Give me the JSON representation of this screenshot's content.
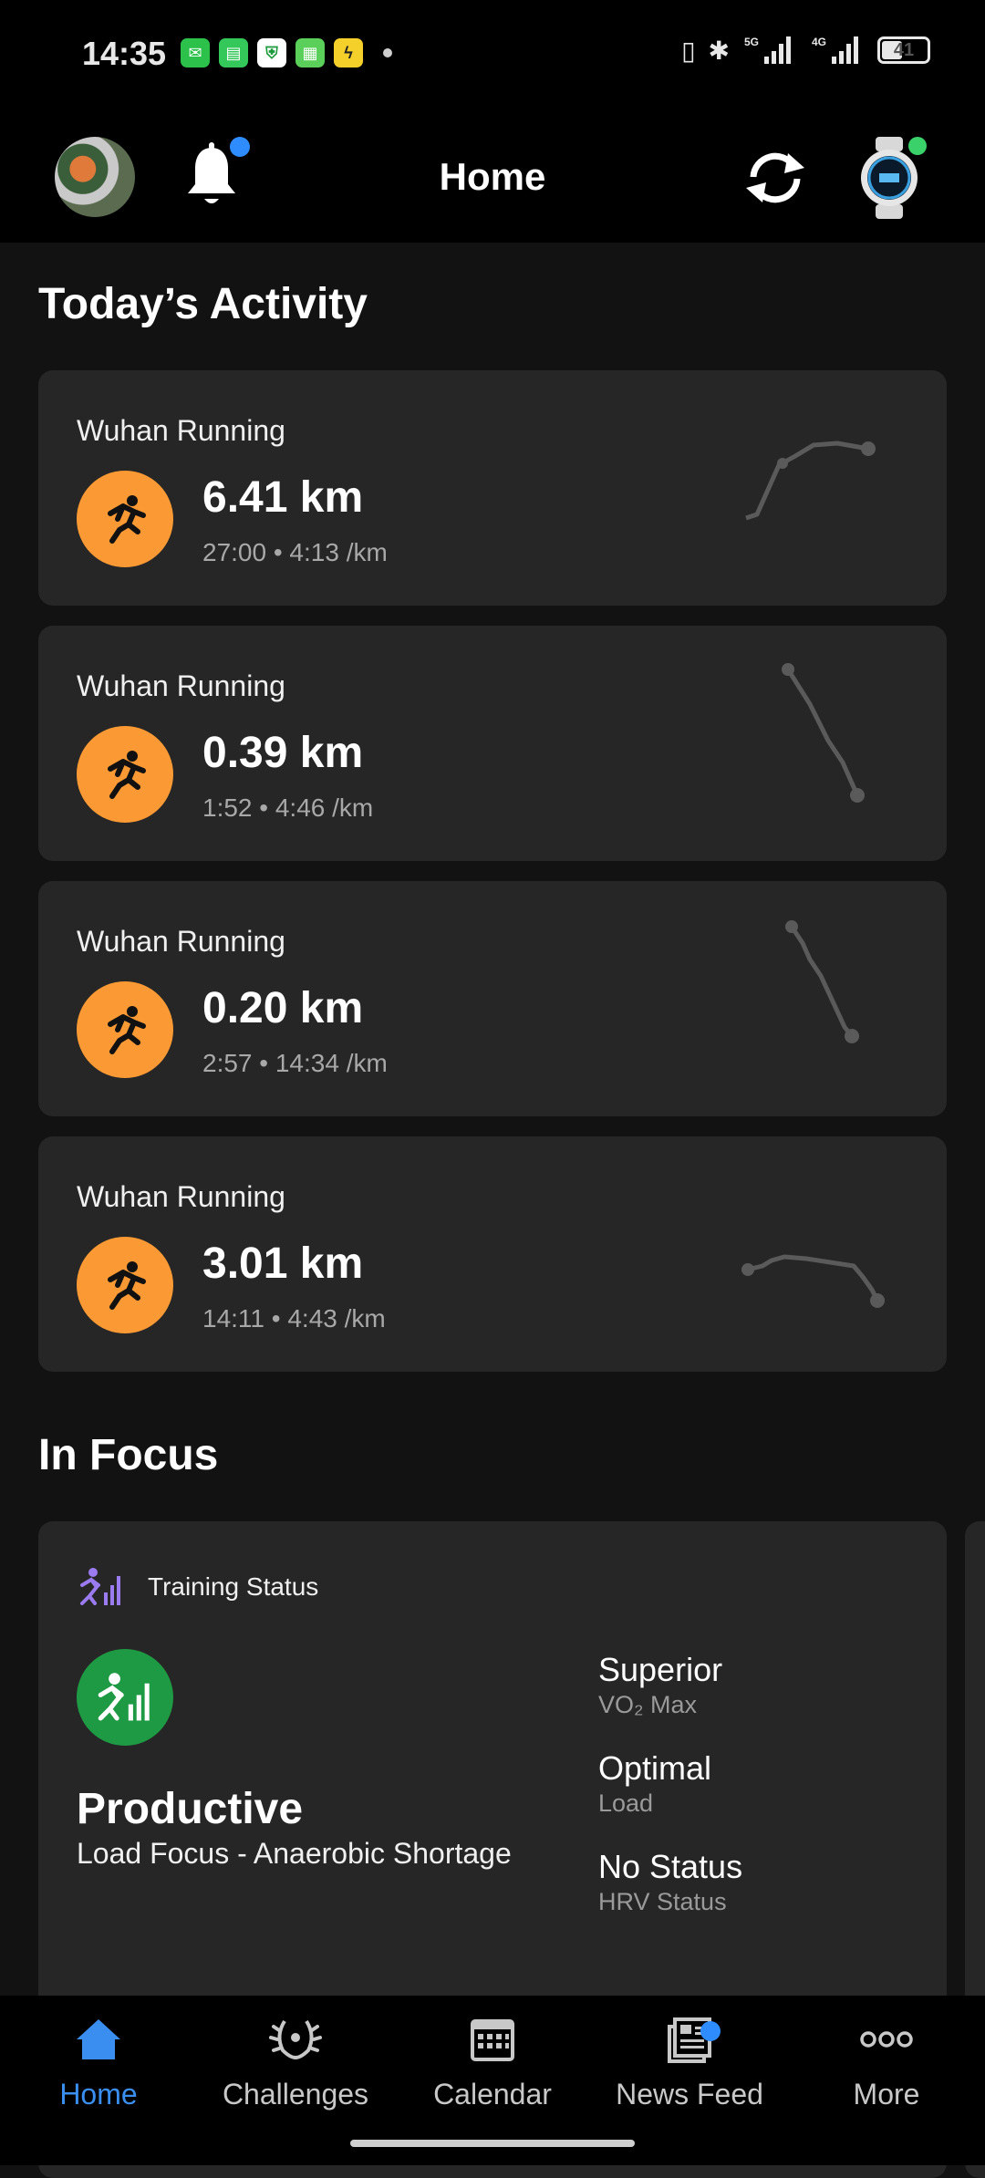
{
  "status_bar": {
    "time": "14:35",
    "network_labels": [
      "5G",
      "4G"
    ],
    "battery": "41"
  },
  "header": {
    "title": "Home"
  },
  "todays_activity": {
    "title": "Today’s Activity",
    "activities": [
      {
        "name": "Wuhan Running",
        "distance": "6.41 km",
        "meta": "27:00 • 4:13 /km"
      },
      {
        "name": "Wuhan Running",
        "distance": "0.39 km",
        "meta": "1:52 • 4:46 /km"
      },
      {
        "name": "Wuhan Running",
        "distance": "0.20 km",
        "meta": "2:57 • 14:34 /km"
      },
      {
        "name": "Wuhan Running",
        "distance": "3.01 km",
        "meta": "14:11 • 4:43 /km"
      }
    ]
  },
  "in_focus": {
    "title": "In Focus",
    "training_status": {
      "label": "Training Status",
      "status": "Productive",
      "subtitle": "Load Focus - Anaerobic Shortage",
      "metrics": [
        {
          "value": "Superior",
          "label": "VO₂ Max"
        },
        {
          "value": "Optimal",
          "label": "Load"
        },
        {
          "value": "No Status",
          "label": "HRV Status"
        }
      ]
    }
  },
  "bottom_nav": {
    "items": [
      {
        "label": "Home",
        "icon": "home-icon",
        "active": true
      },
      {
        "label": "Challenges",
        "icon": "laurel-icon",
        "active": false
      },
      {
        "label": "Calendar",
        "icon": "calendar-icon",
        "active": false
      },
      {
        "label": "News Feed",
        "icon": "newsfeed-icon",
        "active": false
      },
      {
        "label": "More",
        "icon": "more-icon",
        "active": false
      }
    ]
  },
  "colors": {
    "accent": "#3a8ef0",
    "activity_orange": "#fb9a34",
    "status_green": "#1f9a44",
    "card_bg": "#262626",
    "notification_dot": "#2e8cff"
  }
}
